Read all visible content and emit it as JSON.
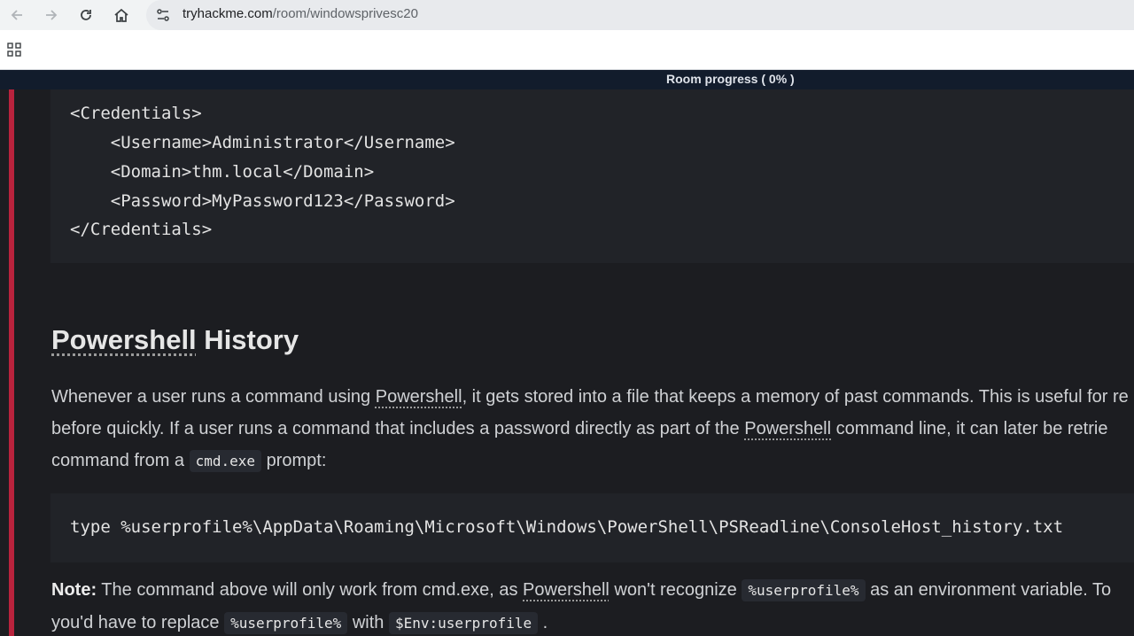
{
  "browser": {
    "url_domain": "tryhackme.com",
    "url_path": "/room/windowsprivesc20"
  },
  "progress": {
    "label": "Room progress ( 0% )",
    "percent": 0
  },
  "xml_block": {
    "lines": [
      "<Credentials>",
      "    <Username>Administrator</Username>",
      "    <Domain>thm.local</Domain>",
      "    <Password>MyPassword123</Password>",
      "</Credentials>"
    ]
  },
  "section": {
    "heading_word1": "Powershell",
    "heading_word2": " History",
    "para1": {
      "l1_a": "Whenever a user runs a command using ",
      "l1_link": "Powershell",
      "l1_b": ", it gets stored into a file that keeps a memory of past commands. This is useful for re",
      "l2_a": "before quickly. If a user runs a command that includes a password directly as part of the ",
      "l2_link": "Powershell",
      "l2_b": " command line, it can later be retrie",
      "l3_a": "command from a ",
      "l3_code": "cmd.exe",
      "l3_b": " prompt:"
    },
    "command": "type %userprofile%\\AppData\\Roaming\\Microsoft\\Windows\\PowerShell\\PSReadline\\ConsoleHost_history.txt",
    "note": {
      "label": "Note:",
      "l1_a": " The command above will only work from cmd.exe, as ",
      "l1_link": "Powershell",
      "l1_b": " won't recognize ",
      "l1_code": "%userprofile%",
      "l1_c": " as an environment variable. To",
      "l2_a": "you'd have to replace ",
      "l2_code1": "%userprofile%",
      "l2_b": " with ",
      "l2_code2": "$Env:userprofile",
      "l2_c": " ."
    }
  }
}
